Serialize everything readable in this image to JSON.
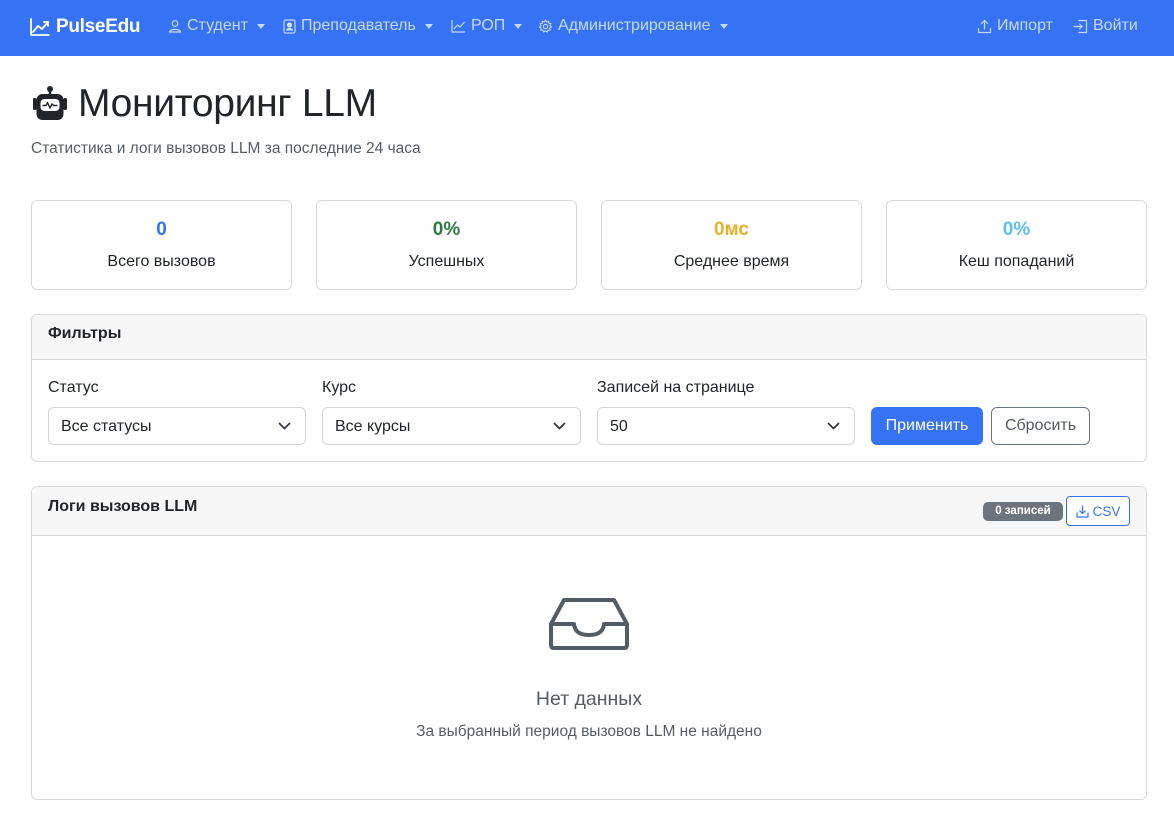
{
  "navbar": {
    "brand": "PulseEdu",
    "items": [
      {
        "label": "Студент",
        "icon": "person-icon"
      },
      {
        "label": "Преподаватель",
        "icon": "badge-icon"
      },
      {
        "label": "РОП",
        "icon": "graph-icon"
      },
      {
        "label": "Администрирование",
        "icon": "gear-icon"
      }
    ],
    "import_label": "Импорт",
    "login_label": "Войти",
    "bg_color": "#3573f4"
  },
  "header": {
    "title": "Мониторинг LLM",
    "subtitle": "Статистика и логи вызовов LLM за последние 24 часа",
    "icon": "robot-icon"
  },
  "stats": [
    {
      "value": "0",
      "label": "Всего вызовов",
      "color": "#3573f4"
    },
    {
      "value": "0%",
      "label": "Успешных",
      "color": "#2f7a44"
    },
    {
      "value": "0мс",
      "label": "Среднее время",
      "color": "#e6b12a"
    },
    {
      "value": "0%",
      "label": "Кеш попаданий",
      "color": "#5bc0ea"
    }
  ],
  "filters": {
    "title": "Фильтры",
    "status_label": "Статус",
    "status_value": "Все статусы",
    "course_label": "Курс",
    "course_value": "Все курсы",
    "per_page_label": "Записей на странице",
    "per_page_value": "50",
    "apply_label": "Применить",
    "reset_label": "Сбросить"
  },
  "logs": {
    "title": "Логи вызовов LLM",
    "badge": "0 записей",
    "csv_label": "CSV",
    "empty_title": "Нет данных",
    "empty_subtitle": "За выбранный период вызовов LLM не найдено",
    "empty_icon": "inbox-icon"
  }
}
